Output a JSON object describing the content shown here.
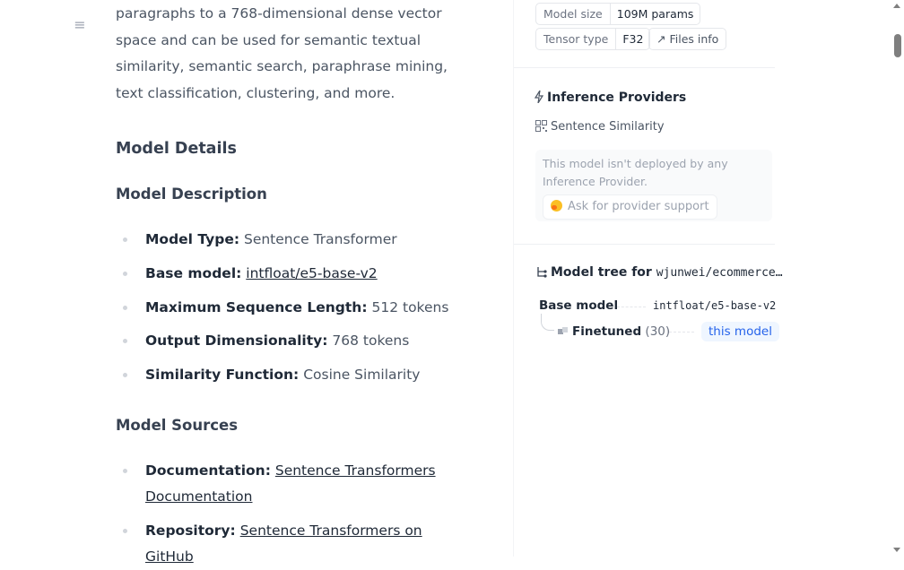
{
  "content": {
    "intro_paragraph": "paragraphs to a 768-dimensional dense vector space and can be used for semantic textual similarity, semantic search, paraphrase mining, text classification, clustering, and more.",
    "model_details_heading": "Model Details",
    "model_description_heading": "Model Description",
    "description_items": [
      {
        "label": "Model Type:",
        "value": " Sentence Transformer"
      },
      {
        "label": "Base model:",
        "link": "intfloat/e5-base-v2"
      },
      {
        "label": "Maximum Sequence Length:",
        "value": " 512 tokens"
      },
      {
        "label": "Output Dimensionality:",
        "value": " 768 tokens"
      },
      {
        "label": "Similarity Function:",
        "value": " Cosine Similarity"
      }
    ],
    "model_sources_heading": "Model Sources",
    "source_items": [
      {
        "label": "Documentation:",
        "link": "Sentence Transformers Documentation"
      },
      {
        "label": "Repository:",
        "link": "Sentence Transformers on GitHub"
      }
    ]
  },
  "sidebar": {
    "model_size_label": "Model size",
    "model_size_value": "109M params",
    "tensor_type_label": "Tensor type",
    "tensor_type_value": "F32",
    "files_info_label": "Files info",
    "inference_title": "Inference Providers",
    "task_label": "Sentence Similarity",
    "not_deployed_note": "This model isn't deployed by any Inference Provider.",
    "ask_support_label": "Ask for provider support",
    "model_tree_prefix": "Model tree for",
    "model_tree_repo": "wjunwei/ecommerce…",
    "base_model_label": "Base model",
    "base_model_value": "intfloat/e5-base-v2",
    "finetuned_label": "Finetuned",
    "finetuned_count": "(30)",
    "this_model_badge": "this model"
  },
  "colors": {
    "badge_bg": "#eff6ff",
    "badge_text": "#2563eb",
    "icon_accent": "#f97316"
  },
  "icons": [
    "menu-icon",
    "bolt-icon",
    "qr-grid-icon",
    "arrow-up-right-icon",
    "hug-icon",
    "tree-icon",
    "cube-icon"
  ]
}
